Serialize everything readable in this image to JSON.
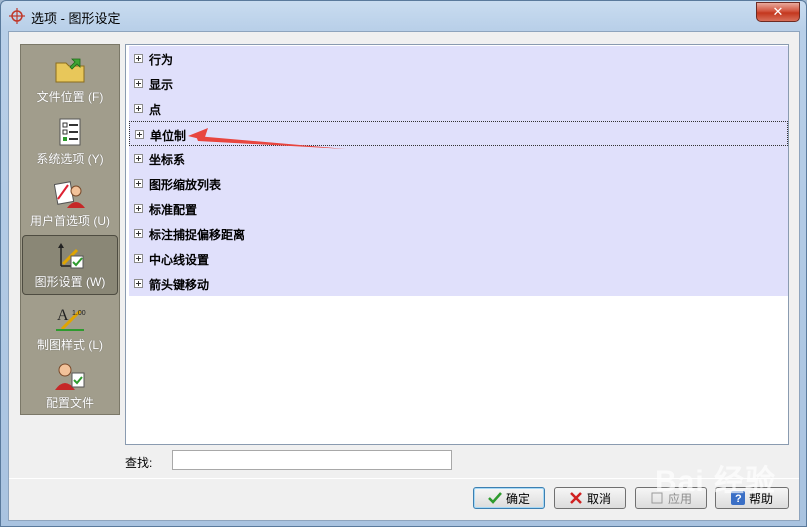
{
  "window": {
    "title": "选项 - 图形设定",
    "close_glyph": "✕"
  },
  "sidebar": {
    "items": [
      {
        "label": "文件位置 (F)",
        "icon": "folder-icon",
        "active": false
      },
      {
        "label": "系统选项 (Y)",
        "icon": "checklist-icon",
        "active": false
      },
      {
        "label": "用户首选项 (U)",
        "icon": "user-preferences-icon",
        "active": false
      },
      {
        "label": "图形设置 (W)",
        "icon": "drawing-settings-icon",
        "active": true
      },
      {
        "label": "制图样式 (L)",
        "icon": "drafting-style-icon",
        "active": false
      },
      {
        "label": "配置文件",
        "icon": "profile-icon",
        "active": false
      }
    ]
  },
  "tree": {
    "items": [
      {
        "label": "行为"
      },
      {
        "label": "显示"
      },
      {
        "label": "点"
      },
      {
        "label": "单位制",
        "selected": true
      },
      {
        "label": "坐标系"
      },
      {
        "label": "图形缩放列表"
      },
      {
        "label": "标准配置"
      },
      {
        "label": "标注捕捉偏移距离"
      },
      {
        "label": "中心线设置"
      },
      {
        "label": "箭头键移动"
      }
    ]
  },
  "find": {
    "label": "查找:",
    "value": ""
  },
  "buttons": {
    "ok": "确定",
    "cancel": "取消",
    "apply": "应用",
    "help": "帮助"
  },
  "watermark": "Bai 经验",
  "colors": {
    "accent_row": "#e0e0fb",
    "sidebar": "#a19d8c",
    "annotation_arrow": "#e8463f"
  }
}
